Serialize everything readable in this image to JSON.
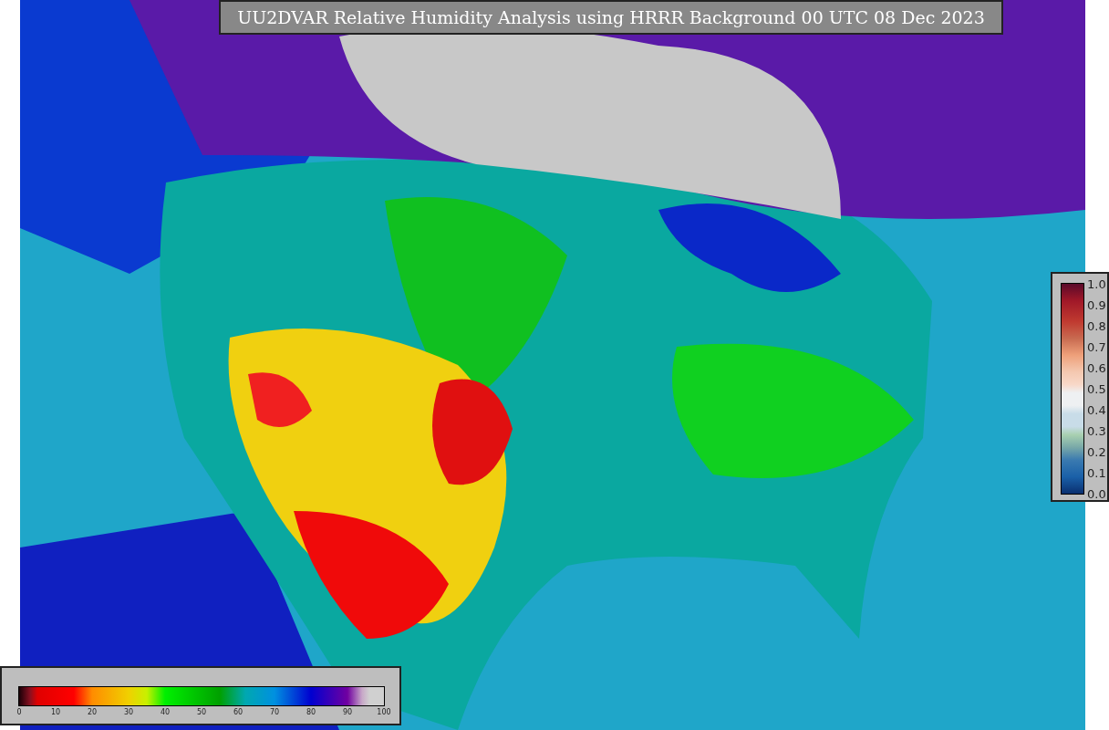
{
  "title": "UU2DVAR Relative Humidity Analysis using HRRR Background 00 UTC 08 Dec 2023",
  "humidity_colorbar": {
    "ticks": [
      "0",
      "10",
      "20",
      "30",
      "40",
      "50",
      "60",
      "70",
      "80",
      "90",
      "100"
    ]
  },
  "ratio_colorbar": {
    "ticks": [
      "1.0",
      "0.9",
      "0.8",
      "0.7",
      "0.6",
      "0.5",
      "0.4",
      "0.3",
      "0.2",
      "0.1",
      "0.0"
    ]
  }
}
